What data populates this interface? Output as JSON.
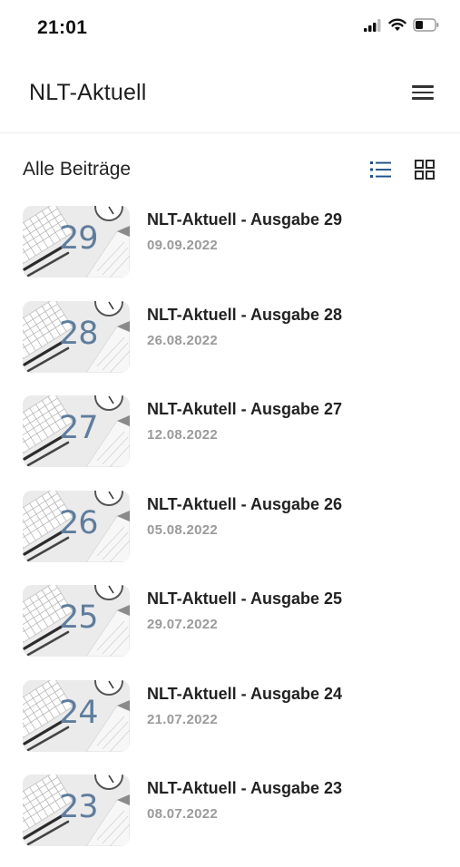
{
  "status_bar": {
    "time": "21:01",
    "icons": [
      "signal-icon",
      "wifi-icon",
      "battery-icon"
    ]
  },
  "header": {
    "title": "NLT-Aktuell",
    "menu_icon": "hamburger-menu-icon"
  },
  "section": {
    "title": "Alle Beiträge",
    "view_icons": [
      "list-view-icon",
      "grid-view-icon"
    ],
    "active_view": "list",
    "accent_color": "#1f4f8a"
  },
  "posts": [
    {
      "number": "29",
      "title": "NLT-Aktuell - Ausgabe 29",
      "date": "09.09.2022"
    },
    {
      "number": "28",
      "title": "NLT-Aktuell - Ausgabe 28",
      "date": "26.08.2022"
    },
    {
      "number": "27",
      "title": "NLT-Akutell - Ausgabe 27",
      "date": "12.08.2022"
    },
    {
      "number": "26",
      "title": "NLT-Aktuell - Ausgabe 26",
      "date": "05.08.2022"
    },
    {
      "number": "25",
      "title": "NLT-Aktuell - Ausgabe 25",
      "date": "29.07.2022"
    },
    {
      "number": "24",
      "title": "NLT-Aktuell - Ausgabe 24",
      "date": "21.07.2022"
    },
    {
      "number": "23",
      "title": "NLT-Aktuell - Ausgabe 23",
      "date": "08.07.2022"
    }
  ]
}
